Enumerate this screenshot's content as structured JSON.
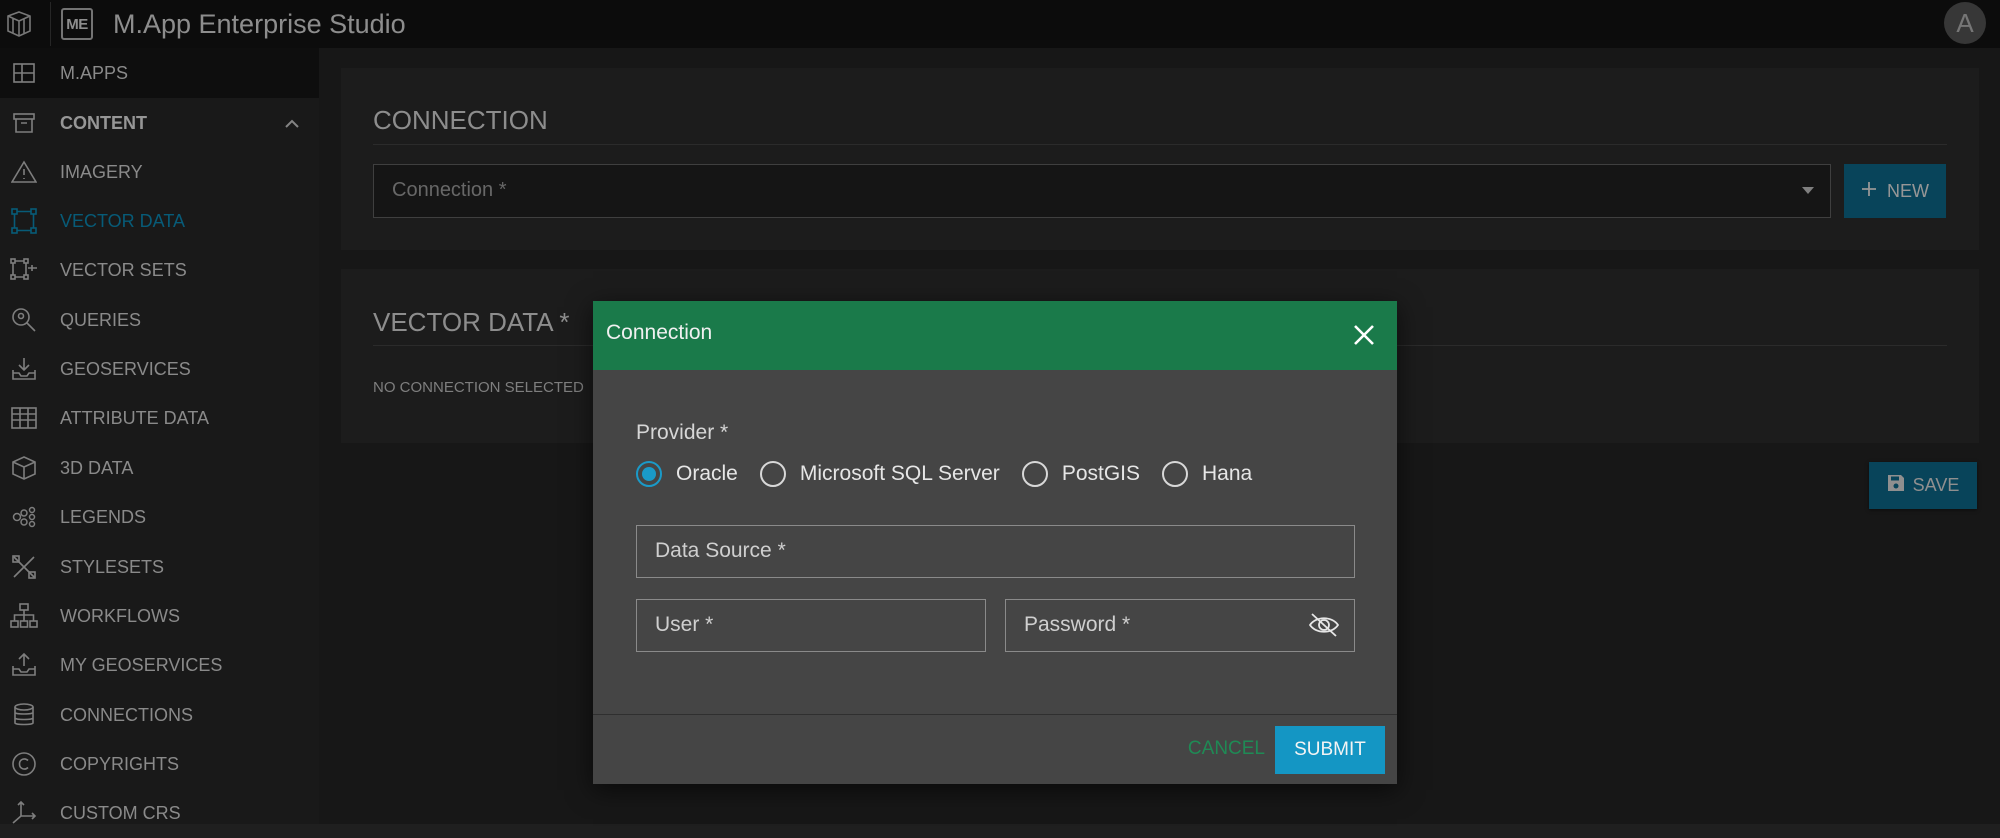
{
  "header": {
    "badge": "ME",
    "title": "M.App Enterprise Studio",
    "avatar_initial": "A"
  },
  "sidebar": {
    "items": [
      {
        "label": "M.APPS",
        "icon": "grid-icon"
      },
      {
        "label": "CONTENT",
        "icon": "archive-box-icon"
      },
      {
        "label": "IMAGERY",
        "icon": "warning-triangle-icon"
      },
      {
        "label": "VECTOR DATA",
        "icon": "vector-square-icon"
      },
      {
        "label": "VECTOR SETS",
        "icon": "vector-sets-icon"
      },
      {
        "label": "QUERIES",
        "icon": "search-pin-icon"
      },
      {
        "label": "GEOSERVICES",
        "icon": "download-tray-icon"
      },
      {
        "label": "ATTRIBUTE DATA",
        "icon": "table-icon"
      },
      {
        "label": "3D DATA",
        "icon": "cube-icon"
      },
      {
        "label": "LEGENDS",
        "icon": "legend-icon"
      },
      {
        "label": "STYLESETS",
        "icon": "styles-icon"
      },
      {
        "label": "WORKFLOWS",
        "icon": "workflow-icon"
      },
      {
        "label": "MY GEOSERVICES",
        "icon": "upload-tray-icon"
      },
      {
        "label": "CONNECTIONS",
        "icon": "database-icon"
      },
      {
        "label": "COPYRIGHTS",
        "icon": "copyright-icon"
      },
      {
        "label": "CUSTOM CRS",
        "icon": "axes-icon"
      }
    ]
  },
  "main": {
    "connection_card": {
      "title": "CONNECTION",
      "select_placeholder": "Connection *",
      "new_button": "NEW"
    },
    "vector_card": {
      "title": "VECTOR DATA *",
      "empty_text": "NO CONNECTION SELECTED"
    },
    "save_button": "SAVE"
  },
  "modal": {
    "title": "Connection",
    "provider_label": "Provider *",
    "providers": [
      {
        "label": "Oracle",
        "checked": true
      },
      {
        "label": "Microsoft SQL Server",
        "checked": false
      },
      {
        "label": "PostGIS",
        "checked": false
      },
      {
        "label": "Hana",
        "checked": false
      }
    ],
    "fields": {
      "data_source": "Data Source *",
      "user": "User *",
      "password": "Password *"
    },
    "cancel": "CANCEL",
    "submit": "SUBMIT"
  },
  "colors": {
    "accent": "#1496c4",
    "modal_header": "#1a7a4a",
    "active_nav": "#0a7aa0"
  }
}
